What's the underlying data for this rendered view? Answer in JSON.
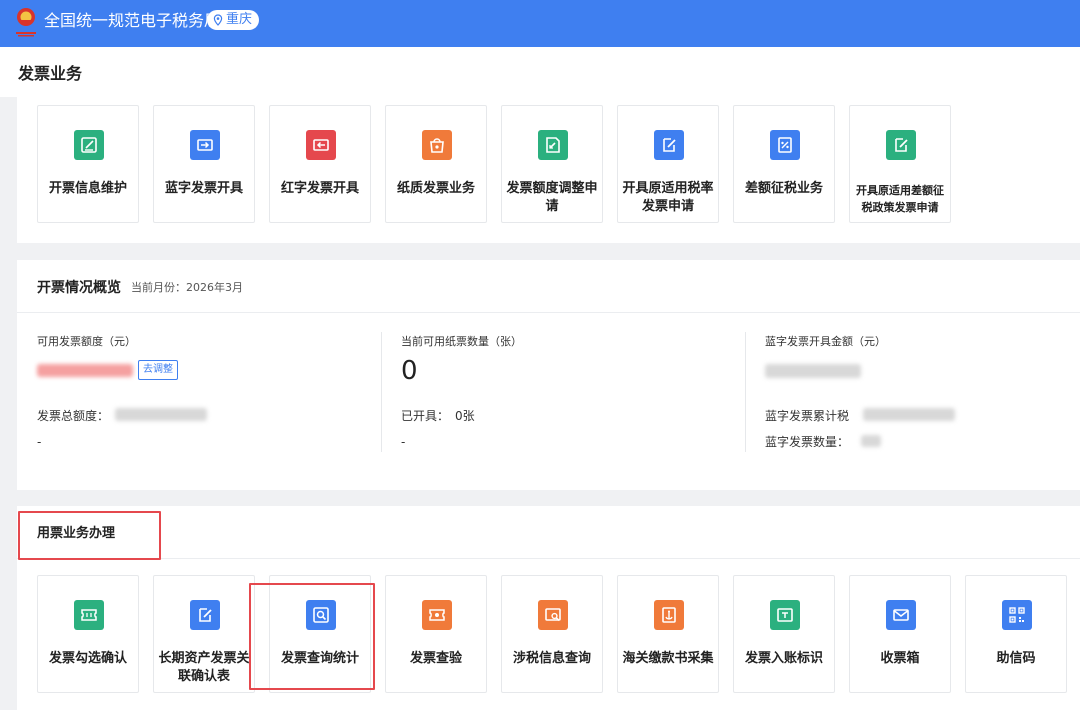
{
  "header": {
    "brand": "全国统一规范电子税务局",
    "region": "重庆",
    "logo_icon": "tax-emblem-icon",
    "pin_icon": "location-pin-icon"
  },
  "page_title": "发票业务",
  "top_tiles": [
    {
      "name": "invoice-info-maintenance",
      "label": "开票信息维护",
      "color": "#2bb07f",
      "icon": "edit-icon"
    },
    {
      "name": "blue-invoice-issue",
      "label": "蓝字发票开具",
      "color": "#3f7ff0",
      "icon": "arrow-ticket-icon"
    },
    {
      "name": "red-invoice-issue",
      "label": "红字发票开具",
      "color": "#e5484d",
      "icon": "return-ticket-icon"
    },
    {
      "name": "paper-invoice-business",
      "label": "纸质发票业务",
      "color": "#f07a3a",
      "icon": "paper-bag-icon"
    },
    {
      "name": "invoice-quota-adjust",
      "label": "发票额度调整申请",
      "color": "#2bb07f",
      "icon": "quota-doc-icon"
    },
    {
      "name": "original-tax-rate-invoice",
      "label": "开具原适用税率发票申请",
      "color": "#3f7ff0",
      "icon": "pencil-note-icon"
    },
    {
      "name": "differential-tax-business",
      "label": "差额征税业务",
      "color": "#3f7ff0",
      "icon": "percent-doc-icon"
    },
    {
      "name": "original-differential-policy-invoice",
      "label": "开具原适用差额征税政策发票申请",
      "color": "#2bb07f",
      "icon": "pencil-note-icon"
    }
  ],
  "overview": {
    "title": "开票情况概览",
    "month_label": "当前月份：2026年3月",
    "available_quota_label": "可用发票额度（元）",
    "adjust_button": "去调整",
    "total_quota_label": "发票总额度：",
    "total_quota_sub": "-",
    "paper_count_label": "当前可用纸票数量（张）",
    "paper_count_value": "0",
    "issued_label": "已开具：",
    "issued_value": "0张",
    "issued_sub": "-",
    "blue_amount_label": "蓝字发票开具金额（元）",
    "blue_tax_label": "蓝字发票累计税",
    "blue_count_label": "蓝字发票数量："
  },
  "business": {
    "title": "用票业务办理",
    "tiles": [
      {
        "name": "invoice-check-confirm",
        "label": "发票勾选确认",
        "color": "#2bb07f",
        "icon": "ticket-check-icon"
      },
      {
        "name": "long-term-asset-invoice",
        "label": "长期资产发票关联确认表",
        "color": "#3f7ff0",
        "icon": "pencil-note-icon"
      },
      {
        "name": "invoice-query-stats",
        "label": "发票查询统计",
        "color": "#3f7ff0",
        "icon": "search-doc-icon"
      },
      {
        "name": "invoice-verify",
        "label": "发票查验",
        "color": "#f07a3a",
        "icon": "verify-ticket-icon"
      },
      {
        "name": "tax-info-query",
        "label": "涉税信息查询",
        "color": "#f07a3a",
        "icon": "search-card-icon"
      },
      {
        "name": "customs-payment-collect",
        "label": "海关缴款书采集",
        "color": "#f07a3a",
        "icon": "anchor-doc-icon"
      },
      {
        "name": "invoice-booking-mark",
        "label": "发票入账标识",
        "color": "#2bb07f",
        "icon": "ledger-icon"
      },
      {
        "name": "invoice-mailbox",
        "label": "收票箱",
        "color": "#3f7ff0",
        "icon": "mail-icon"
      },
      {
        "name": "trust-code",
        "label": "助信码",
        "color": "#3f7ff0",
        "icon": "qr-code-icon"
      }
    ]
  }
}
